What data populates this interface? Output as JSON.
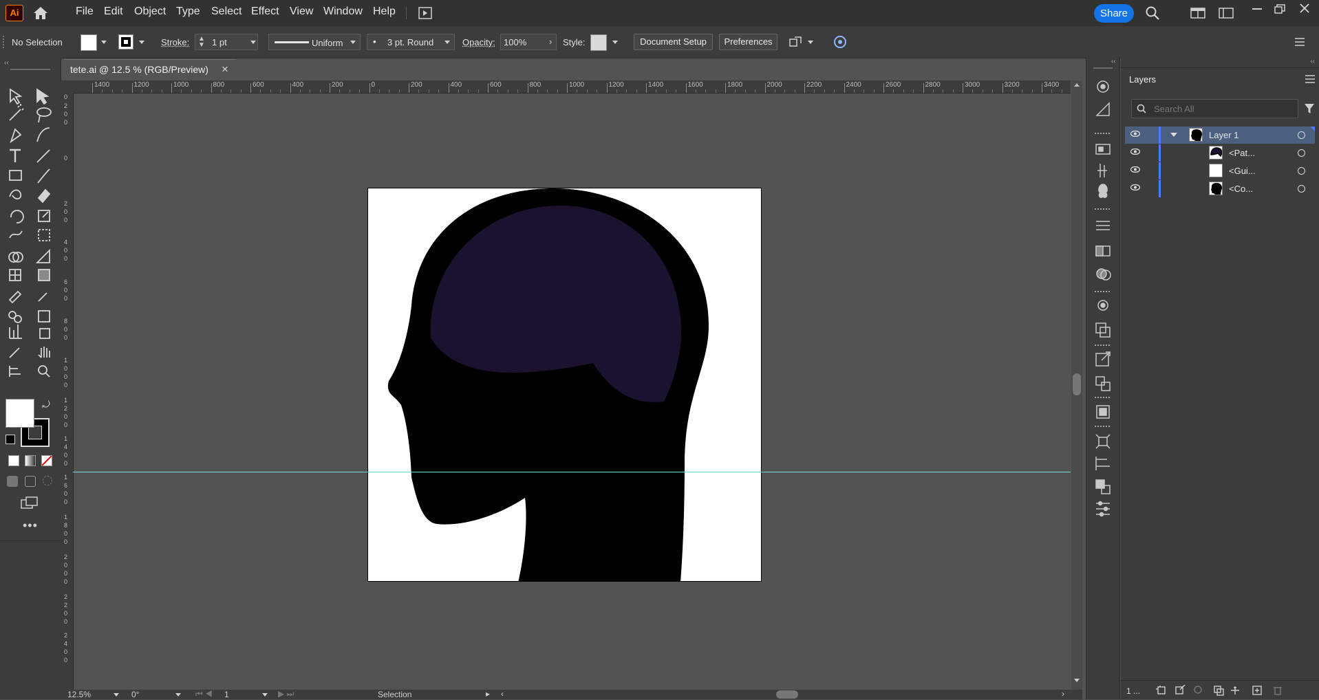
{
  "app": {
    "logo": "Ai",
    "accent": "#1473e6",
    "logo_color": "#ff7c00"
  },
  "menu": {
    "items": [
      "File",
      "Edit",
      "Object",
      "Type",
      "Select",
      "Effect",
      "View",
      "Window",
      "Help"
    ],
    "share_label": "Share"
  },
  "control": {
    "selection_status": "No Selection",
    "stroke_label": "Stroke:",
    "stroke_weight": "1 pt",
    "stroke_profile": "Uniform",
    "brush": "3 pt. Round",
    "opacity_label": "Opacity:",
    "opacity_value": "100%",
    "style_label": "Style:",
    "document_setup": "Document Setup",
    "preferences": "Preferences"
  },
  "document": {
    "tab_title": "tete.ai @ 12.5 % (RGB/Preview)",
    "close_glyph": "×"
  },
  "ruler": {
    "h_ticks": [
      "1400",
      "1200",
      "1000",
      "800",
      "600",
      "400",
      "200",
      "0",
      "200",
      "400",
      "600",
      "800",
      "1000",
      "1200",
      "1400",
      "1600",
      "1800",
      "2000",
      "2200",
      "2400",
      "2600",
      "2800",
      "3000",
      "3200",
      "3400"
    ]
  },
  "status": {
    "zoom": "12.5%",
    "rotation": "0°",
    "artboard_number": "1",
    "tool_name": "Selection"
  },
  "layers_panel": {
    "title": "Layers",
    "search_placeholder": "Search All",
    "rows": [
      {
        "name": "Layer 1",
        "type": "layer"
      },
      {
        "name": "<Pat...",
        "type": "path"
      },
      {
        "name": "<Gui...",
        "type": "guide"
      },
      {
        "name": "<Co...",
        "type": "compound"
      }
    ],
    "footer_count": "1 ..."
  },
  "colors": {
    "head_fill": "#000000",
    "brain_fill": "#1b1230",
    "guide": "#7fd6e6",
    "layer_color": "#4b7bff"
  }
}
